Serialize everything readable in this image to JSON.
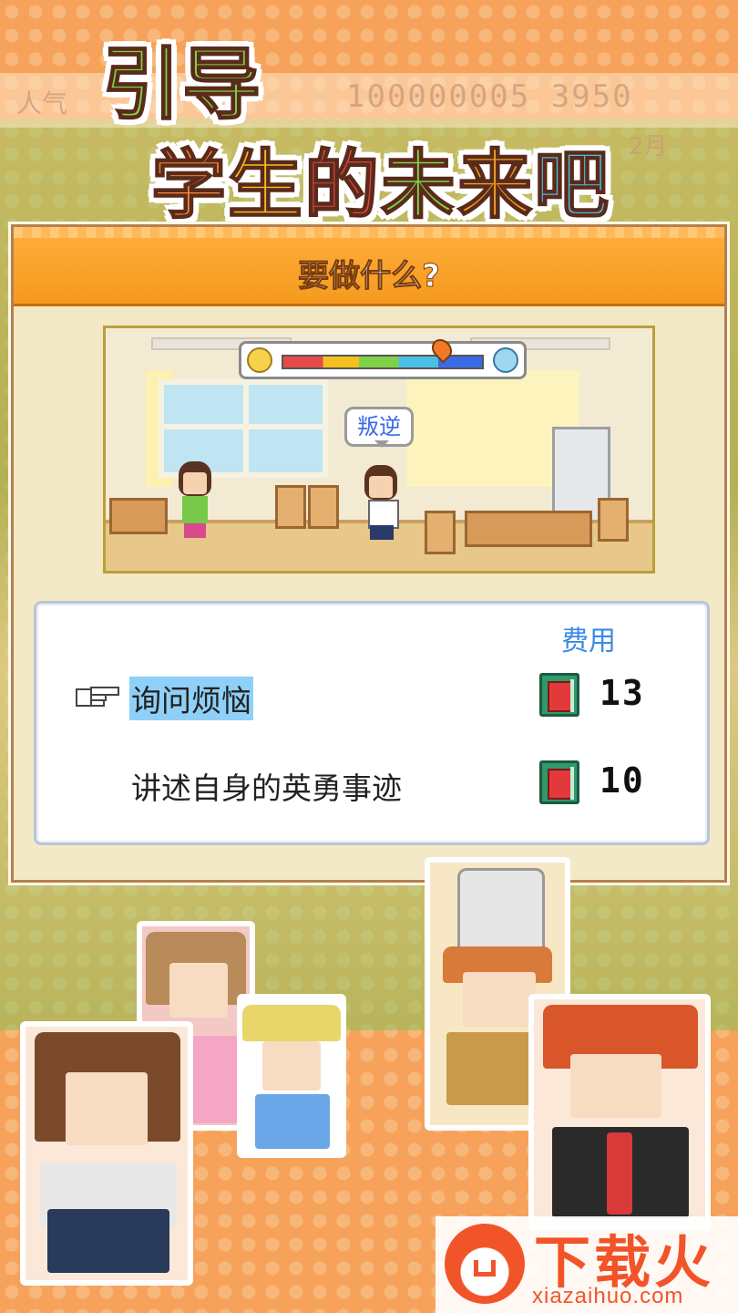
{
  "headline": {
    "line1": "引导",
    "line2_chars": [
      "学",
      "生",
      "的",
      "未",
      "来",
      "吧"
    ]
  },
  "hud": {
    "left": "人气",
    "money": "100000005 3950",
    "month": "2月"
  },
  "dialog": {
    "title": "要做什么?",
    "scene": {
      "speech_bubble": "叛逆"
    },
    "cost_header": "费用",
    "options": [
      {
        "label": "询问烦恼",
        "cost": "13",
        "selected": true
      },
      {
        "label": "讲述自身的英勇事迹",
        "cost": "10",
        "selected": false
      }
    ]
  },
  "watermark": {
    "brand": "下载火",
    "url": "xiazaihuo.com"
  },
  "colors": {
    "accent_orange": "#f59a1e",
    "selection": "#8fd0f8",
    "cost_header": "#3a8ae6"
  }
}
